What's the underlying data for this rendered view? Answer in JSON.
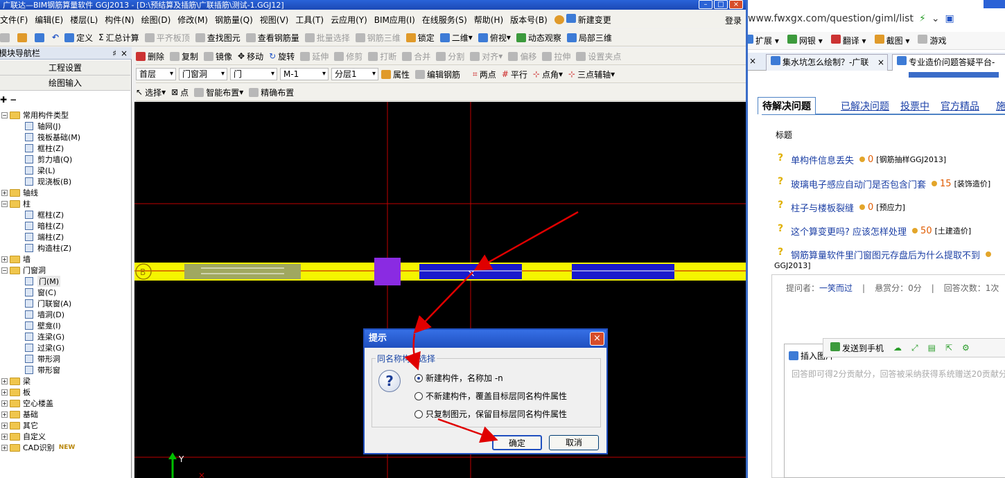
{
  "app": {
    "title": "广联达—BIM钢筋算量软件 GGJ2013 - [D:\\预结算及插筋\\广联插筋\\测试-1.GGJ12]",
    "menus": [
      "文件(F)",
      "编辑(E)",
      "楼层(L)",
      "构件(N)",
      "绘图(D)",
      "修改(M)",
      "钢筋量(Q)",
      "视图(V)",
      "工具(T)",
      "云应用(Y)",
      "BIM应用(I)",
      "在线服务(S)",
      "帮助(H)",
      "版本号(B)"
    ],
    "new_change": "新建变更",
    "login": "登录",
    "toolbar1": {
      "define": "定义",
      "sum": "汇总计算",
      "flat_board": "平齐板顶",
      "find": "查找图元",
      "view_rebar": "查看钢筋量",
      "batch_select": "批量选择",
      "rebar_3d": "钢筋三维",
      "lock": "锁定",
      "view2d": "二维",
      "top_view": "俯视",
      "dynamic": "动态观察",
      "local3d": "局部三维"
    },
    "toolbar2": {
      "delete": "删除",
      "copy": "复制",
      "mirror": "镜像",
      "move": "移动",
      "rotate": "旋转",
      "extend": "延伸",
      "trim": "修剪",
      "break": "打断",
      "merge": "合并",
      "split": "分割",
      "align": "对齐",
      "offset": "偏移",
      "stretch": "拉伸",
      "set_point": "设置夹点"
    },
    "toolbar3": {
      "floor": "首层",
      "category": "门窗洞",
      "type": "门",
      "component": "M-1",
      "layer": "分层1",
      "property": "属性",
      "edit_rebar": "编辑钢筋",
      "two_point": "两点",
      "parallel": "平行",
      "point_angle": "点角",
      "three_point": "三点辅轴"
    },
    "toolbar4": {
      "select": "选择",
      "point": "点",
      "smart": "智能布置",
      "precise": "精确布置"
    }
  },
  "nav": {
    "title": "模块导航栏",
    "pin": "♯",
    "close": "×",
    "project_settings": "工程设置",
    "drawing_input": "绘图输入",
    "tree": [
      {
        "level": 1,
        "pm": "−",
        "label": "常用构件类型"
      },
      {
        "level": 2,
        "label": "轴网(J)"
      },
      {
        "level": 2,
        "label": "筏板基础(M)"
      },
      {
        "level": 2,
        "label": "框柱(Z)"
      },
      {
        "level": 2,
        "label": "剪力墙(Q)"
      },
      {
        "level": 2,
        "label": "梁(L)"
      },
      {
        "level": 2,
        "label": "现浇板(B)"
      },
      {
        "level": 1,
        "pm": "+",
        "label": "轴线"
      },
      {
        "level": 1,
        "pm": "−",
        "label": "柱"
      },
      {
        "level": 2,
        "label": "框柱(Z)"
      },
      {
        "level": 2,
        "label": "暗柱(Z)"
      },
      {
        "level": 2,
        "label": "端柱(Z)"
      },
      {
        "level": 2,
        "label": "构造柱(Z)"
      },
      {
        "level": 1,
        "pm": "+",
        "label": "墙"
      },
      {
        "level": 1,
        "pm": "−",
        "label": "门窗洞"
      },
      {
        "level": 2,
        "label": "门(M)",
        "selected": true
      },
      {
        "level": 2,
        "label": "窗(C)"
      },
      {
        "level": 2,
        "label": "门联窗(A)"
      },
      {
        "level": 2,
        "label": "墙洞(D)"
      },
      {
        "level": 2,
        "label": "壁龛(I)"
      },
      {
        "level": 2,
        "label": "连梁(G)"
      },
      {
        "level": 2,
        "label": "过梁(G)"
      },
      {
        "level": 2,
        "label": "带形洞"
      },
      {
        "level": 2,
        "label": "带形窗"
      },
      {
        "level": 1,
        "pm": "+",
        "label": "梁"
      },
      {
        "level": 1,
        "pm": "+",
        "label": "板"
      },
      {
        "level": 1,
        "pm": "+",
        "label": "空心楼盖"
      },
      {
        "level": 1,
        "pm": "+",
        "label": "基础"
      },
      {
        "level": 1,
        "pm": "+",
        "label": "其它"
      },
      {
        "level": 1,
        "pm": "+",
        "label": "自定义"
      },
      {
        "level": 1,
        "pm": "+",
        "label": "CAD识别",
        "badge": "NEW"
      }
    ]
  },
  "canvas": {
    "axis_label": "B",
    "y_label": "Y",
    "colors": {
      "wall": "#f5f500",
      "column": "#8a2be2",
      "door": "#1a1acc",
      "grid": "#c00000",
      "window": "#a0a860"
    }
  },
  "dialog": {
    "title": "提示",
    "close": "×",
    "group": "同名称构件选择",
    "options": [
      "新建构件，名称加 -n",
      "不新建构件，覆盖目标层同名构件属性",
      "只复制图元，保留目标层同名构件属性"
    ],
    "selected": 0,
    "ok": "确定",
    "cancel": "取消"
  },
  "browser": {
    "url": "www.fwxgx.com/question/giml/list",
    "toolbar": {
      "ext": "扩展",
      "bank": "网银",
      "translate": "翻译",
      "screenshot": "截图",
      "game": "游戏"
    },
    "tabs": [
      "集水坑怎么绘制？-广联",
      "专业造价问题答疑平台-"
    ],
    "qtabs": [
      "待解决问题",
      "已解决问题",
      "投票中",
      "官方精品",
      "施工"
    ],
    "header": "标题",
    "questions": [
      {
        "title": "单构件信息丢失",
        "score": "0",
        "cat": "[钢筋抽样GGJ2013]"
      },
      {
        "title": "玻璃电子感应自动门是否包含门套",
        "score": "15",
        "cat": "[装饰造价]"
      },
      {
        "title": "柱子与楼板裂缝",
        "score": "0",
        "cat": "[预应力]"
      },
      {
        "title": "这个算变更吗? 应该怎样处理",
        "score": "50",
        "cat": "[土建造价]"
      },
      {
        "title": "钢筋算量软件里门窗图元存盘后为什么提取不到",
        "score": "",
        "cat": "GGJ2013]"
      }
    ],
    "info": {
      "asker_label": "提问者：",
      "asker": "一笑而过",
      "reward": "悬赏分：0分",
      "answers": "回答次数：1次"
    },
    "insert_image": "插入图片",
    "send_to_phone": "发送到手机",
    "editor_placeholder": "回答即可得2分贡献分，回答被采纳获得系统赠送20贡献分"
  }
}
